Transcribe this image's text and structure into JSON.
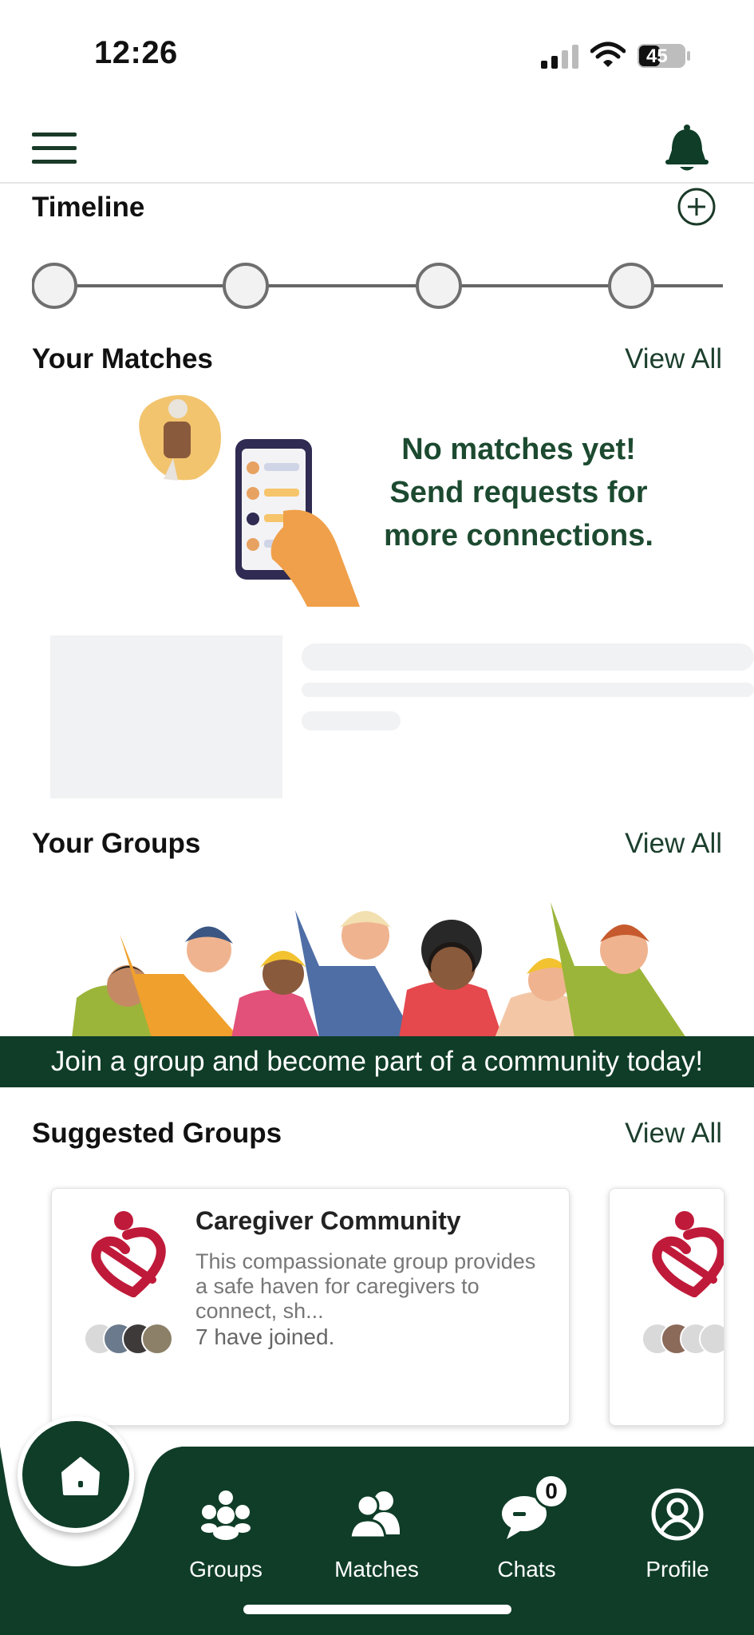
{
  "status_bar": {
    "time": "12:26",
    "battery": "45"
  },
  "timeline": {
    "title": "Timeline",
    "steps": 4
  },
  "matches": {
    "title": "Your Matches",
    "view_all": "View All",
    "empty_line1": "No matches yet!",
    "empty_line2": "Send requests for",
    "empty_line3": "more connections."
  },
  "groups": {
    "title": "Your Groups",
    "view_all": "View All",
    "banner_text": "Join a group and become part of a community today!"
  },
  "suggested": {
    "title": "Suggested Groups",
    "view_all": "View All",
    "cards": [
      {
        "name": "Caregiver Community",
        "description": "This compassionate group provides a safe haven for caregivers to connect, sh...",
        "joined": "7 have joined."
      }
    ]
  },
  "nav": {
    "groups": "Groups",
    "matches": "Matches",
    "chats": "Chats",
    "chats_badge": "0",
    "profile": "Profile"
  },
  "colors": {
    "brand_green": "#0f3d28",
    "text_green": "#1c4a30",
    "logo_red": "#c01a3a"
  }
}
